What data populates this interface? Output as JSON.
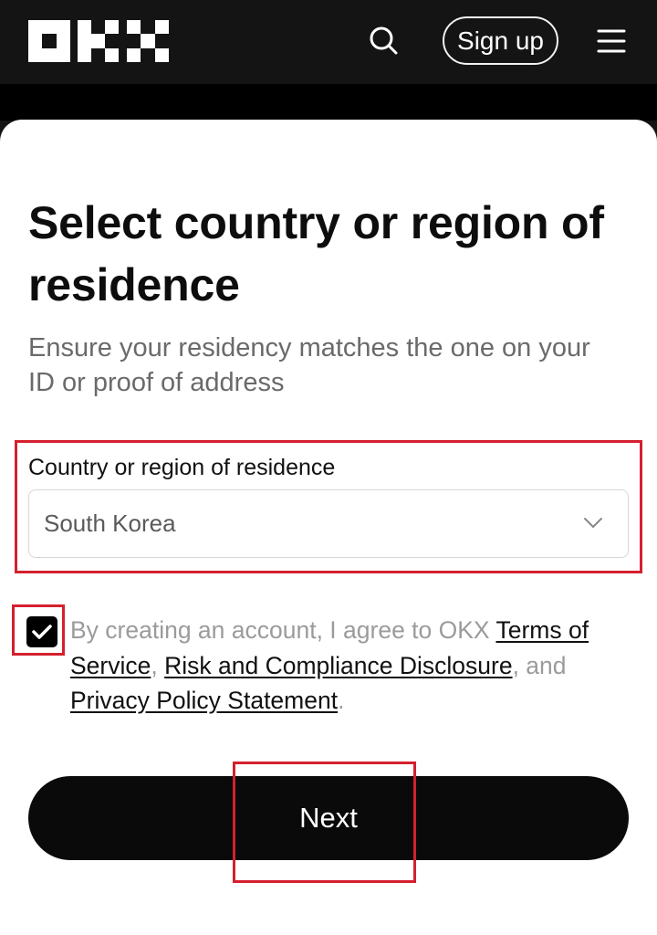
{
  "header": {
    "logo_text": "OKX",
    "search_icon": "search-icon",
    "signup_label": "Sign up",
    "menu_icon": "hamburger-menu-icon"
  },
  "page": {
    "title": "Select country or region of residence",
    "subtitle": "Ensure your residency matches the one on your ID or proof of address"
  },
  "country_field": {
    "label": "Country or region of residence",
    "value": "South Korea",
    "chevron_icon": "chevron-down-icon"
  },
  "consent": {
    "checked": true,
    "prefix": "By creating an account, I agree to OKX ",
    "terms_link": "Terms of Service",
    "sep1": ", ",
    "risk_link": "Risk and Compliance Disclosure",
    "sep2": ", and ",
    "privacy_link": "Privacy Policy Statement",
    "suffix": "."
  },
  "next_button": {
    "label": "Next"
  },
  "colors": {
    "header_bg": "#141414",
    "highlight": "#d4202e",
    "primary_button": "#0a0a0a"
  }
}
